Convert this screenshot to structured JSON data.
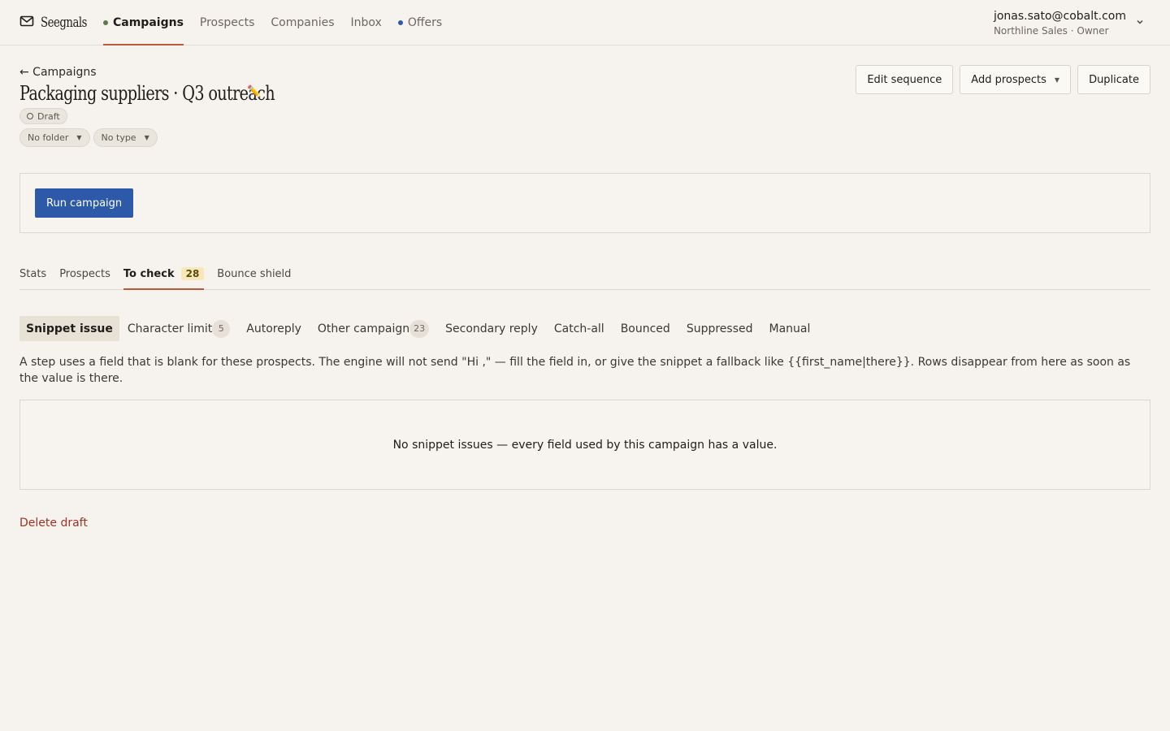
{
  "app": {
    "brand": "Seegnals"
  },
  "nav": {
    "items": [
      {
        "label": "Campaigns",
        "dot_color": "#5a7a4a",
        "active": true
      },
      {
        "label": "Prospects"
      },
      {
        "label": "Companies"
      },
      {
        "label": "Inbox"
      },
      {
        "label": "Offers",
        "dot_color": "#2d5aa8"
      }
    ]
  },
  "user": {
    "email": "jonas.sato@cobalt.com",
    "org": "Northline Sales · Owner"
  },
  "header": {
    "back_label": "← Campaigns",
    "title": "Packaging suppliers · Q3 outreach",
    "edit_icon": "✏️",
    "status": "Draft",
    "folder": "No folder",
    "type": "No type",
    "actions": {
      "edit_sequence": "Edit sequence",
      "add_prospects": "Add prospects",
      "duplicate": "Duplicate"
    }
  },
  "run": {
    "label": "Run campaign",
    "color": "#2d5aa8"
  },
  "tabs": [
    {
      "label": "Stats"
    },
    {
      "label": "Prospects"
    },
    {
      "label": "To check",
      "count": "28",
      "active": true
    },
    {
      "label": "Bounce shield"
    }
  ],
  "subtabs": [
    {
      "label": "Snippet issue",
      "active": true
    },
    {
      "label": "Character limit",
      "count": "5"
    },
    {
      "label": "Autoreply"
    },
    {
      "label": "Other campaign",
      "count": "23"
    },
    {
      "label": "Secondary reply"
    },
    {
      "label": "Catch-all"
    },
    {
      "label": "Bounced"
    },
    {
      "label": "Suppressed"
    },
    {
      "label": "Manual"
    }
  ],
  "snippet": {
    "description": "A step uses a field that is blank for these prospects. The engine will not send \"Hi ,\" — fill the field in, or give the snippet a fallback like {{first_name|there}}. Rows disappear from here as soon as the value is there.",
    "empty_message": "No snippet issues — every field used by this campaign has a value."
  },
  "footer": {
    "delete_label": "Delete draft"
  },
  "colors": {
    "accent_underline": "#b95a3a",
    "danger": "#9b3322",
    "background": "#f6f3ee"
  }
}
